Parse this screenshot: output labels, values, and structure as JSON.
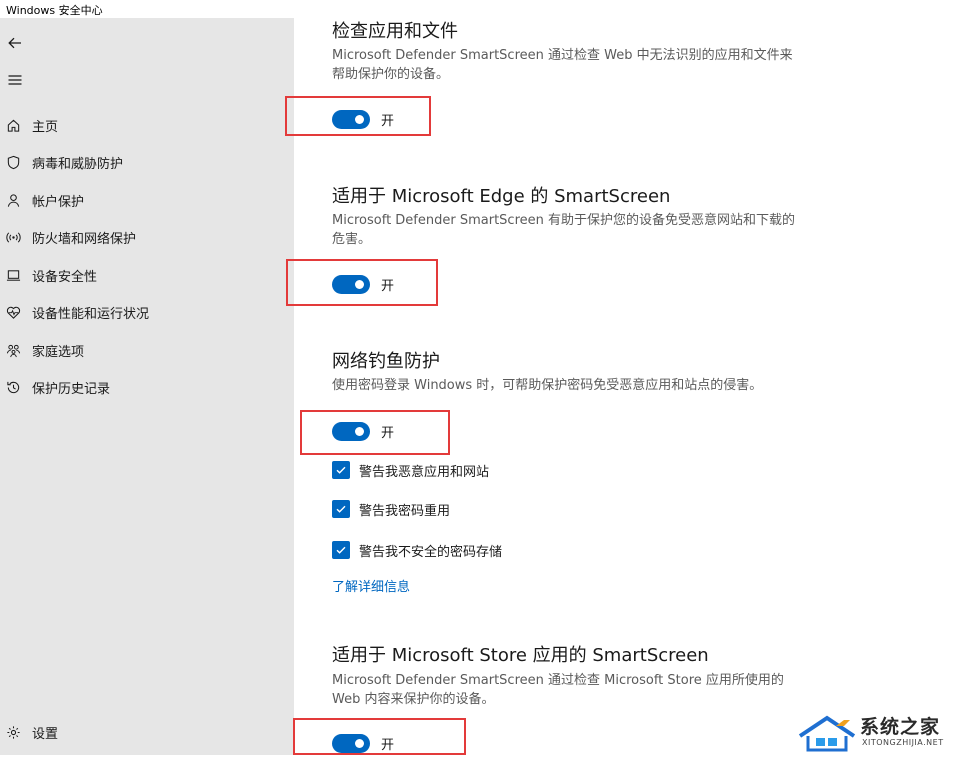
{
  "window": {
    "title": "Windows 安全中心"
  },
  "sidebar": {
    "items": [
      {
        "label": "主页",
        "icon": "home-icon"
      },
      {
        "label": "病毒和威胁防护",
        "icon": "shield-icon"
      },
      {
        "label": "帐户保护",
        "icon": "person-icon"
      },
      {
        "label": "防火墙和网络保护",
        "icon": "wifi-icon"
      },
      {
        "label": "设备安全性",
        "icon": "laptop-icon"
      },
      {
        "label": "设备性能和运行状况",
        "icon": "heart-icon"
      },
      {
        "label": "家庭选项",
        "icon": "family-icon"
      },
      {
        "label": "保护历史记录",
        "icon": "history-icon"
      }
    ],
    "settings_label": "设置"
  },
  "sections": [
    {
      "title": "检查应用和文件",
      "description": "Microsoft Defender SmartScreen 通过检查 Web 中无法识别的应用和文件来帮助保护你的设备。",
      "toggle_label": "开",
      "toggle_on": true
    },
    {
      "title": "适用于 Microsoft Edge 的 SmartScreen",
      "description": "Microsoft Defender SmartScreen 有助于保护您的设备免受恶意网站和下载的危害。",
      "toggle_label": "开",
      "toggle_on": true
    },
    {
      "title": "网络钓鱼防护",
      "description": "使用密码登录 Windows 时，可帮助保护密码免受恶意应用和站点的侵害。",
      "toggle_label": "开",
      "toggle_on": true,
      "checkboxes": [
        {
          "label": "警告我恶意应用和网站",
          "checked": true
        },
        {
          "label": "警告我密码重用",
          "checked": true
        },
        {
          "label": "警告我不安全的密码存储",
          "checked": true
        }
      ],
      "link": "了解详细信息"
    },
    {
      "title": "适用于 Microsoft Store 应用的 SmartScreen",
      "description": "Microsoft Defender SmartScreen 通过检查 Microsoft Store 应用所使用的 Web 内容来保护你的设备。",
      "toggle_label": "开",
      "toggle_on": true
    }
  ],
  "watermark": {
    "name": "系统之家",
    "domain": "XITONGZHIJIA.NET"
  },
  "colors": {
    "accent": "#0067c0",
    "highlight": "#e33a3a",
    "sidebar_bg": "#e6e6e6"
  }
}
